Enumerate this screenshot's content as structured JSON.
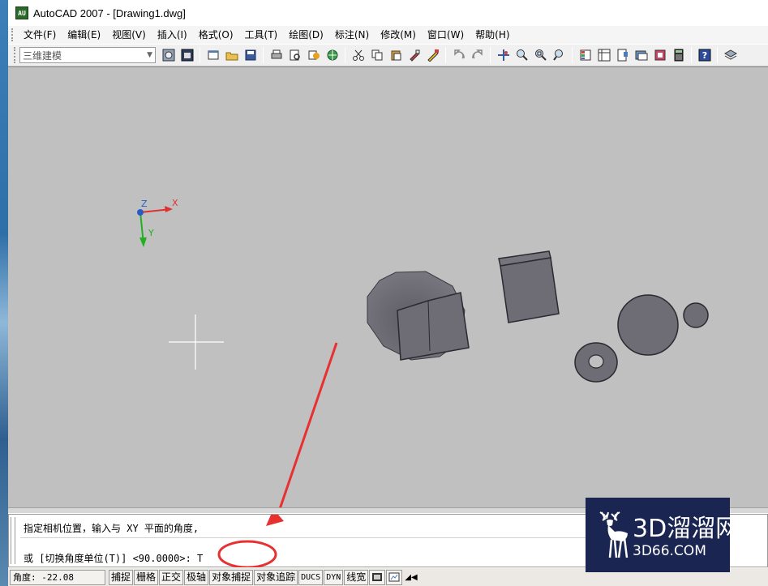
{
  "window": {
    "title": "AutoCAD 2007 - [Drawing1.dwg]",
    "app_icon_label": "AU"
  },
  "menu": {
    "items": [
      "文件(F)",
      "编辑(E)",
      "视图(V)",
      "插入(I)",
      "格式(O)",
      "工具(T)",
      "绘图(D)",
      "标注(N)",
      "修改(M)",
      "窗口(W)",
      "帮助(H)"
    ]
  },
  "toolbar": {
    "workspace_value": "三维建模",
    "icons": [
      "workspace-settings-icon",
      "my-workspace-icon",
      "new-file-icon",
      "open-file-icon",
      "save-icon",
      "plot-icon",
      "plot-preview-icon",
      "publish-icon",
      "3d-dwf-icon",
      "cut-icon",
      "copy-icon",
      "paste-icon",
      "match-properties-icon",
      "block-editor-icon",
      "undo-icon",
      "redo-icon",
      "pan-icon",
      "zoom-realtime-icon",
      "zoom-window-icon",
      "zoom-previous-icon",
      "properties-icon",
      "design-center-icon",
      "tool-palettes-icon",
      "sheet-set-icon",
      "markup-icon",
      "calculator-icon",
      "help-icon",
      "layers-icon"
    ]
  },
  "ucs": {
    "x_label": "X",
    "y_label": "Y",
    "z_label": "Z"
  },
  "command": {
    "line1": "指定相机位置，输入与 XY 平面的角度,",
    "line2": "或 [切换角度单位(T)] <90.0000>: T"
  },
  "status": {
    "coord_label": "角度:",
    "coord_value": "-22.08",
    "buttons": [
      "捕捉",
      "栅格",
      "正交",
      "极轴",
      "对象捕捉",
      "对象追踪",
      "DUCS",
      "DYN",
      "线宽"
    ]
  },
  "watermark": {
    "brand": "3D溜溜网",
    "url": "3D66.COM"
  },
  "colors": {
    "drawing_bg": "#c0c0c0",
    "solid_fill": "#6e6c74",
    "annotation_red": "#e83030",
    "watermark_bg": "#1a2552"
  }
}
